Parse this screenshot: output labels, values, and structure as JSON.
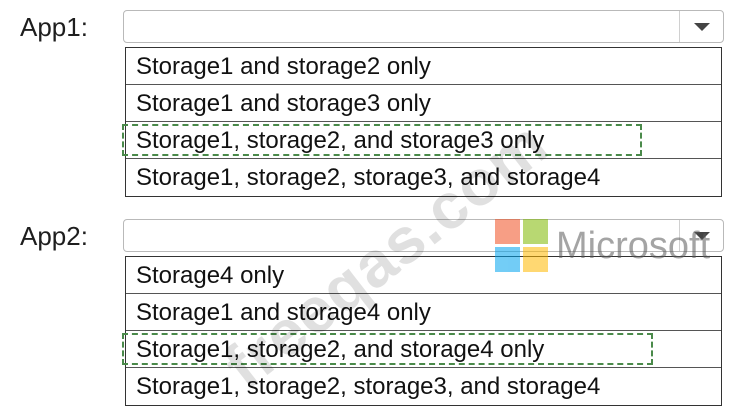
{
  "groups": [
    {
      "label": "App1:",
      "selected_value": "",
      "options": [
        {
          "label": "Storage1 and storage2 only",
          "correct": false
        },
        {
          "label": "Storage1 and storage3 only",
          "correct": false
        },
        {
          "label": "Storage1, storage2, and storage3 only",
          "correct": true
        },
        {
          "label": "Storage1, storage2, storage3, and storage4",
          "correct": false
        }
      ]
    },
    {
      "label": "App2:",
      "selected_value": "",
      "options": [
        {
          "label": "Storage4 only",
          "correct": false
        },
        {
          "label": "Storage1 and storage4 only",
          "correct": false
        },
        {
          "label": "Storage1, storage2, and storage4 only",
          "correct": true
        },
        {
          "label": "Storage1, storage2, storage3, and storage4",
          "correct": false
        }
      ]
    }
  ],
  "icons": {
    "dropdown": "chevron-down-icon",
    "brand_logo": "microsoft-logo-icon"
  },
  "watermark": {
    "text": "freeqas.com"
  },
  "brand": {
    "text": "Microsoft",
    "colors": [
      "#f25022",
      "#7fba00",
      "#00a4ef",
      "#ffb900"
    ]
  },
  "colors": {
    "selection_border": "#4a8a4a",
    "text": "#111111"
  }
}
